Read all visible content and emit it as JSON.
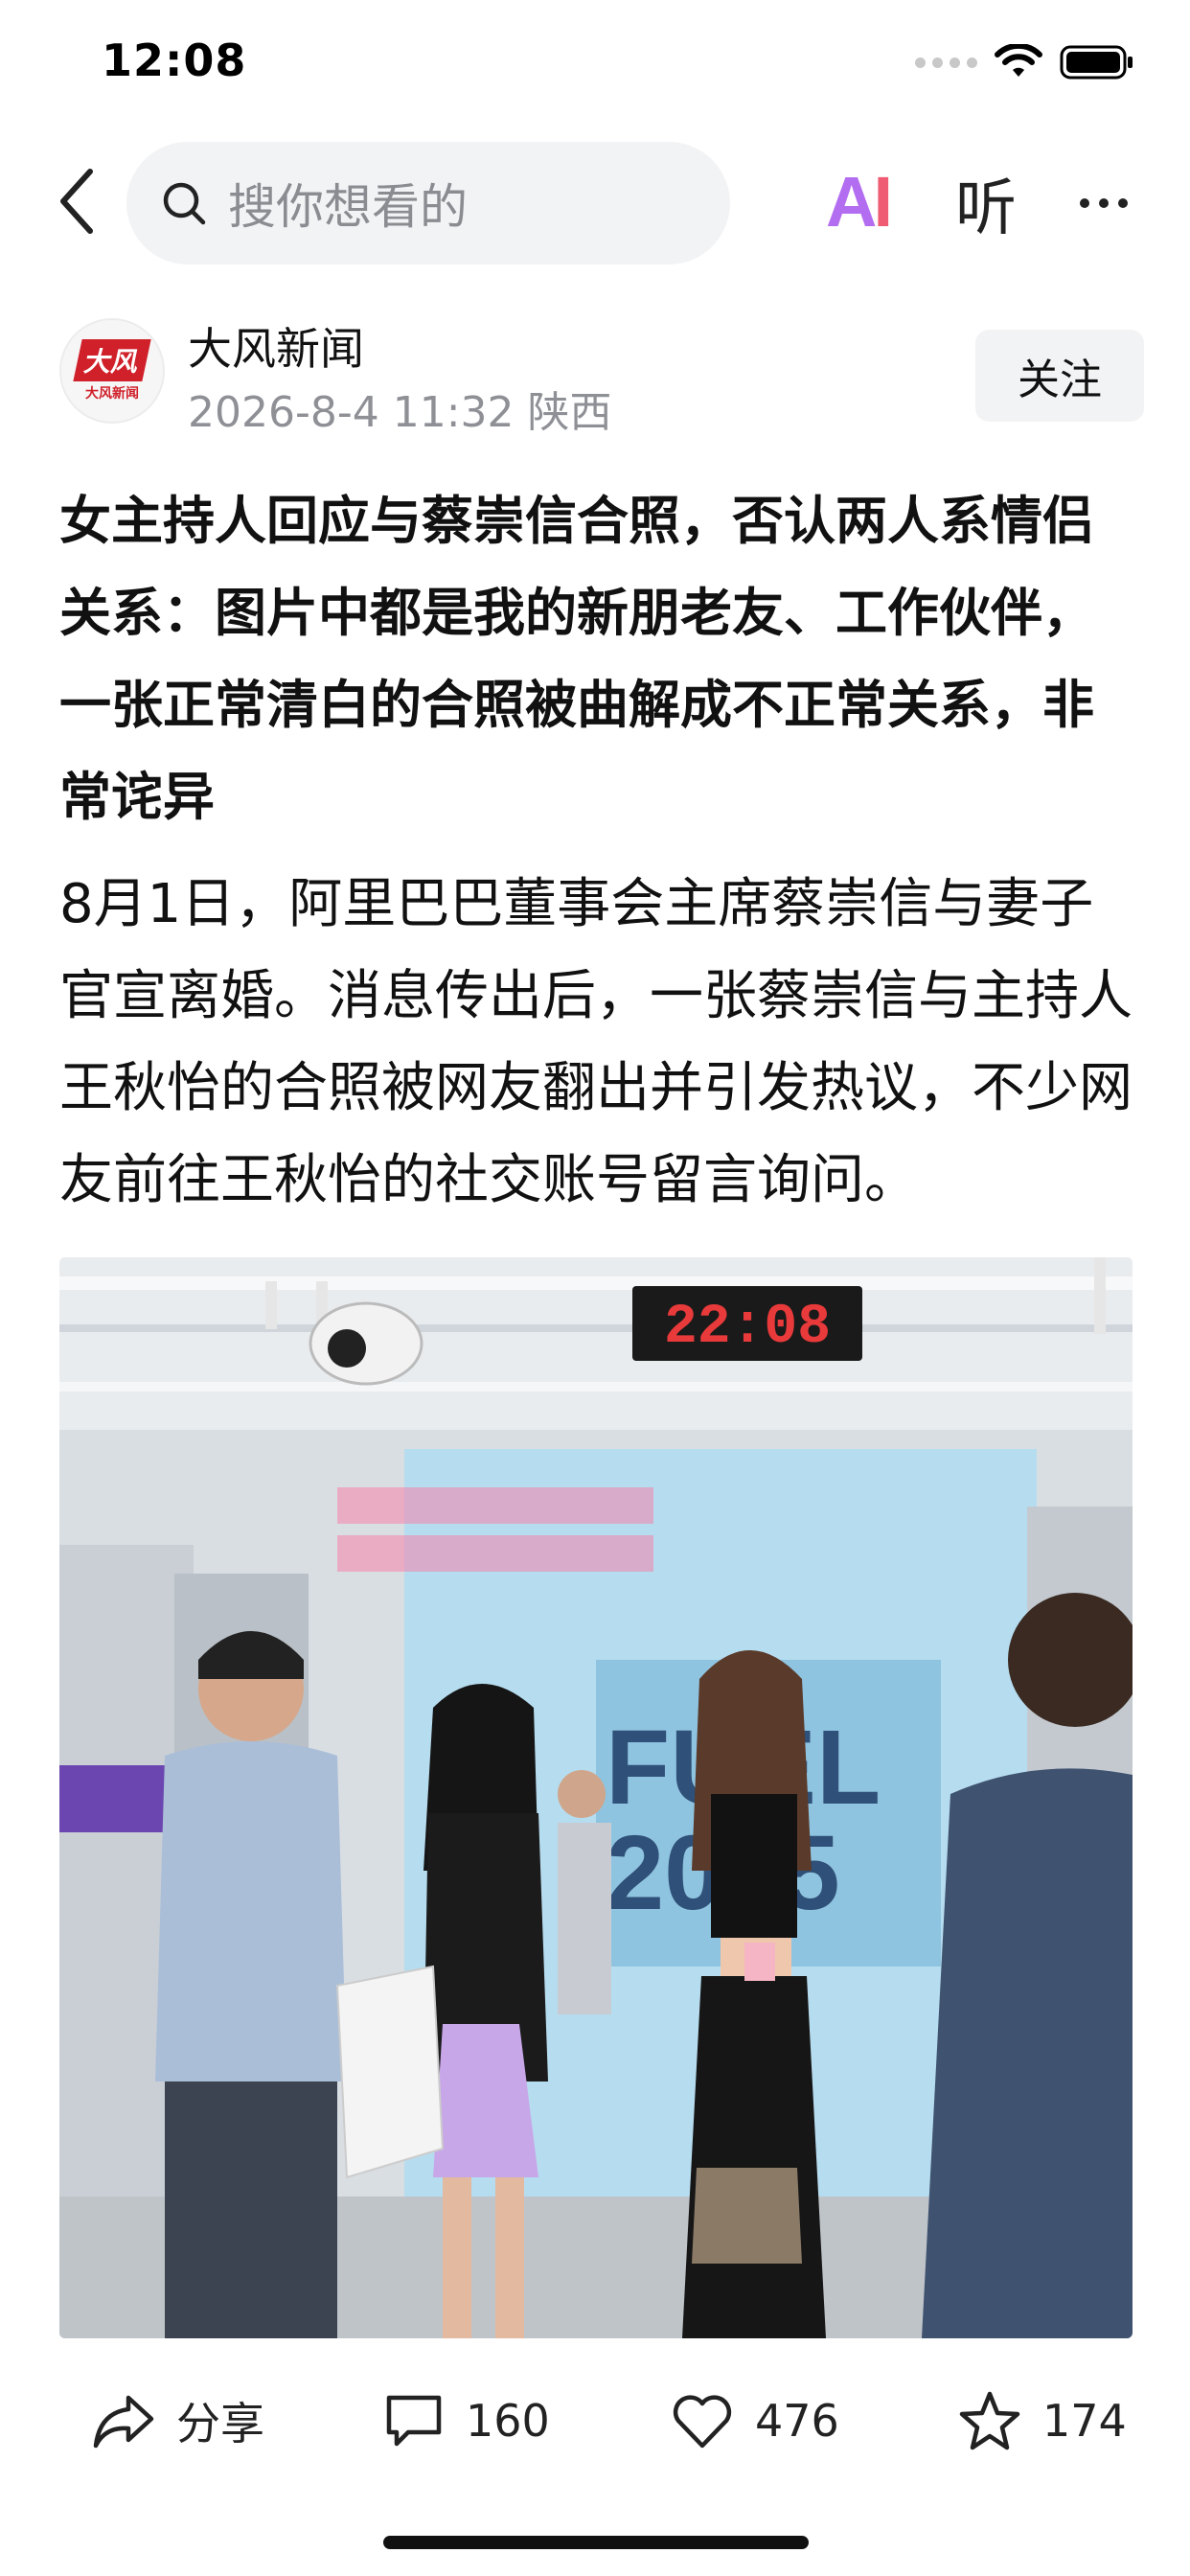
{
  "status_bar": {
    "time": "12:08"
  },
  "nav": {
    "search_placeholder": "搜你想看的",
    "ai_label": "AI",
    "listen_label": "听"
  },
  "author": {
    "avatar_logo": "大风",
    "avatar_sub": "大风新闻",
    "name": "大风新闻",
    "meta": "2026-8-4 11:32 陕西",
    "follow_label": "关注"
  },
  "article": {
    "headline": "女主持人回应与蔡崇信合照，否认两人系情侣关系：图片中都是我的新朋老友、工作伙伴，一张正常清白的合照被曲解成不正常关系，非常诧异",
    "body": "8月1日，阿里巴巴董事会主席蔡崇信与妻子官宣离婚。消息传出后，一张蔡崇信与主持人王秋怡的合照被网友翻出并引发热议，不少网友前往王秋怡的社交账号留言询问。",
    "photo_clock": "22:08"
  },
  "actions": {
    "share_label": "分享",
    "comment_count": "160",
    "like_count": "476",
    "favorite_count": "174"
  },
  "colors": {
    "search_bg": "#f2f3f5",
    "ai_gradient_start": "#b36df0",
    "ai_gradient_end": "#ee5b72",
    "meta_gray": "#8e9096",
    "brand_red": "#d0202a"
  }
}
